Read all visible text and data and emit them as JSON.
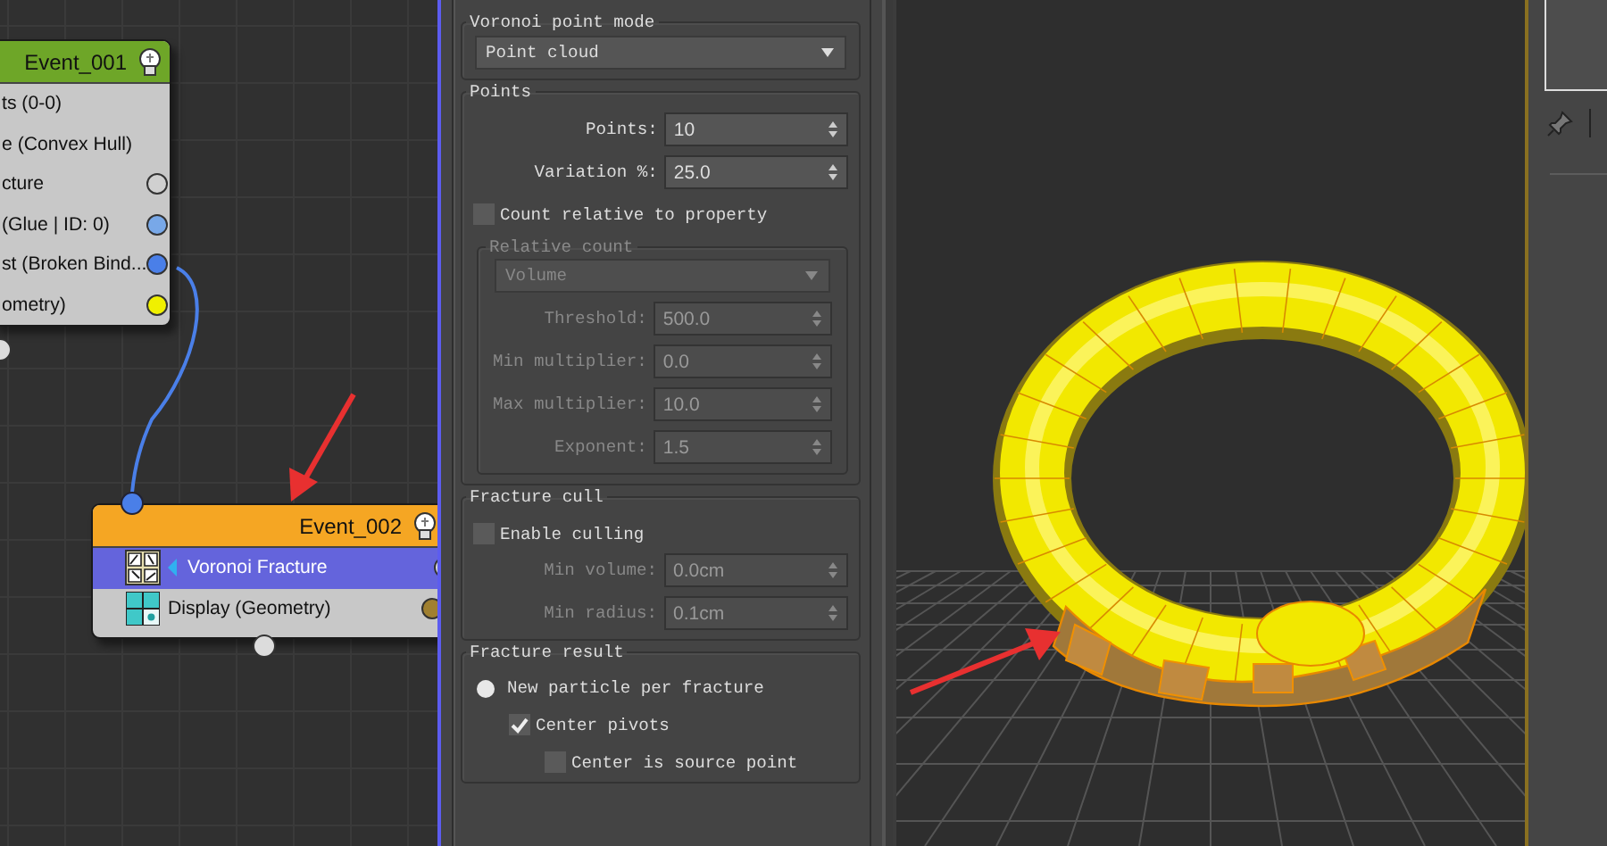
{
  "node_editor": {
    "nodes": [
      {
        "title": "Event_001",
        "color": "#6ea628",
        "operators": [
          {
            "label": "ts (0-0)",
            "selected": false
          },
          {
            "label": "e (Convex Hull)",
            "selected": false
          },
          {
            "label": "cture",
            "selected": false,
            "color": "#d0d0d0"
          },
          {
            "label": "(Glue | ID: 0)",
            "selected": false,
            "color": "#78a8e8"
          },
          {
            "label": "st (Broken Bind...",
            "selected": false,
            "color": "#4a7fe8"
          },
          {
            "label": "ometry)",
            "selected": false,
            "color": "#f0f000"
          }
        ]
      },
      {
        "title": "Event_002",
        "color": "#f5a623",
        "operators": [
          {
            "kind": "fracture",
            "label": "Voronoi Fracture",
            "selected": true,
            "color": "#d8d8d8"
          },
          {
            "kind": "display",
            "label": "Display (Geometry)",
            "selected": false,
            "color": "#a08030"
          }
        ]
      }
    ]
  },
  "properties": {
    "groups": [
      {
        "title": "Voronoi point mode",
        "controls": [
          {
            "kind": "dropdown",
            "value": "Point cloud",
            "disabled": false
          }
        ]
      },
      {
        "title": "Points",
        "controls": [
          {
            "kind": "spinner",
            "label": "Points:",
            "value": "10",
            "disabled": false
          },
          {
            "kind": "spinner",
            "label": "Variation %:",
            "value": "25.0",
            "disabled": false
          },
          {
            "kind": "checkbox",
            "label": "Count relative to property",
            "checked": false,
            "disabled": false
          },
          {
            "kind": "group",
            "title": "Relative count",
            "disabled": true,
            "controls": [
              {
                "kind": "dropdown",
                "value": "Volume",
                "disabled": true
              },
              {
                "kind": "spinner",
                "label": "Threshold:",
                "value": "500.0",
                "disabled": true
              },
              {
                "kind": "spinner",
                "label": "Min multiplier:",
                "value": "0.0",
                "disabled": true
              },
              {
                "kind": "spinner",
                "label": "Max multiplier:",
                "value": "10.0",
                "disabled": true
              },
              {
                "kind": "spinner",
                "label": "Exponent:",
                "value": "1.5",
                "disabled": true
              }
            ]
          }
        ]
      },
      {
        "title": "Fracture cull",
        "controls": [
          {
            "kind": "checkbox",
            "label": "Enable culling",
            "checked": false,
            "disabled": false
          },
          {
            "kind": "spinner",
            "label": "Min volume:",
            "value": "0.0cm",
            "disabled": true
          },
          {
            "kind": "spinner",
            "label": "Min radius:",
            "value": "0.1cm",
            "disabled": true
          }
        ]
      },
      {
        "title": "Fracture result",
        "controls": [
          {
            "kind": "radio",
            "label": "New particle per fracture",
            "selected": true,
            "disabled": false,
            "children": [
              {
                "kind": "checkbox",
                "label": "Center pivots",
                "checked": true,
                "disabled": false,
                "children": [
                  {
                    "kind": "checkbox",
                    "label": "Center is source point",
                    "checked": false,
                    "disabled": false
                  }
                ]
              }
            ]
          }
        ]
      }
    ]
  }
}
